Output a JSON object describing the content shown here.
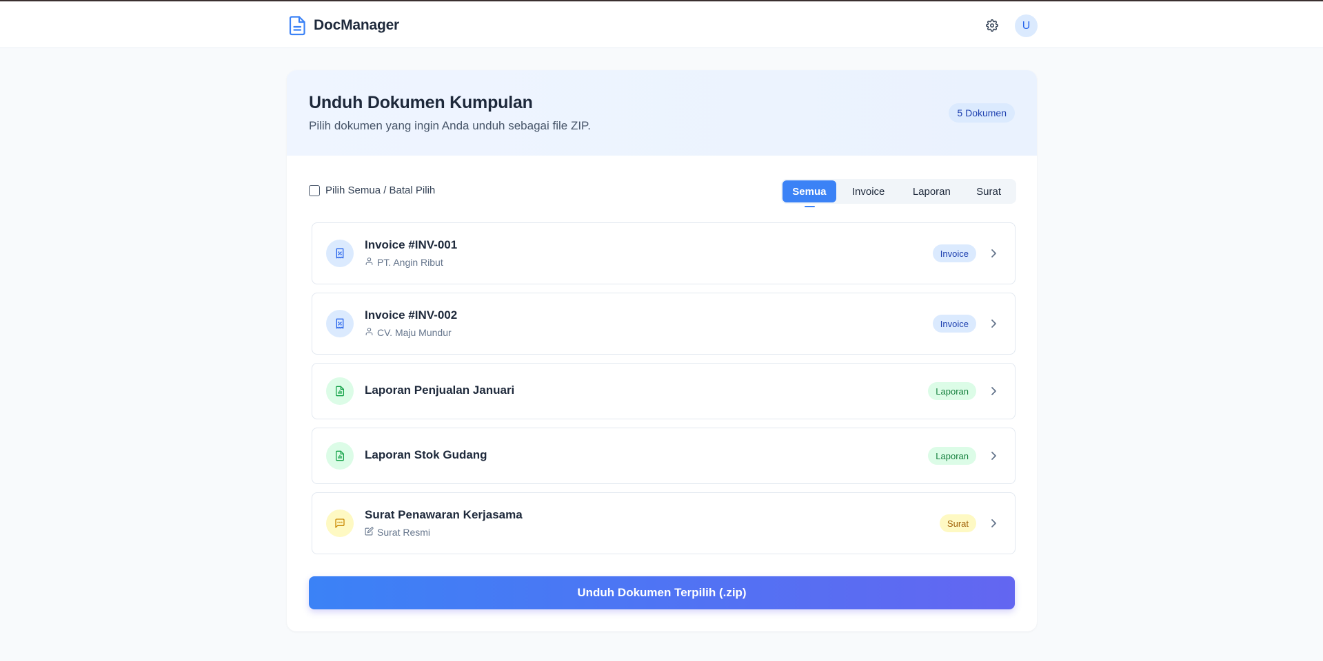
{
  "app": {
    "name": "DocManager"
  },
  "header": {
    "avatar_initial": "U"
  },
  "page": {
    "title": "Unduh Dokumen Kumpulan",
    "subtitle": "Pilih dokumen yang ingin Anda unduh sebagai file ZIP.",
    "count_badge": "5 Dokumen"
  },
  "select_all": {
    "label": "Pilih Semua / Batal Pilih",
    "checked": false
  },
  "filter": {
    "active": "Semua",
    "tabs": [
      {
        "label": "Semua"
      },
      {
        "label": "Invoice"
      },
      {
        "label": "Laporan"
      },
      {
        "label": "Surat"
      }
    ]
  },
  "documents": [
    {
      "title": "Invoice #INV-001",
      "subtitle": "PT. Angin Ribut",
      "subtitle_icon": "user-icon",
      "category": "Invoice",
      "color": "blue",
      "icon": "receipt-icon"
    },
    {
      "title": "Invoice #INV-002",
      "subtitle": "CV. Maju Mundur",
      "subtitle_icon": "user-icon",
      "category": "Invoice",
      "color": "blue",
      "icon": "receipt-icon"
    },
    {
      "title": "Laporan Penjualan Januari",
      "subtitle": "",
      "category": "Laporan",
      "color": "green",
      "icon": "report-icon"
    },
    {
      "title": "Laporan Stok Gudang",
      "subtitle": "",
      "category": "Laporan",
      "color": "green",
      "icon": "report-icon"
    },
    {
      "title": "Surat Penawaran Kerjasama",
      "subtitle": "Surat Resmi",
      "subtitle_icon": "edit-icon",
      "category": "Surat",
      "color": "yellow",
      "icon": "message-icon"
    }
  ],
  "actions": {
    "download_label": "Unduh Dokumen Terpilih (.zip)"
  },
  "colors": {
    "primary": "#3b82f6",
    "gradient_end": "#6366f1",
    "invoice": "#2563eb",
    "laporan": "#16a34a",
    "surat": "#ca8a04"
  }
}
